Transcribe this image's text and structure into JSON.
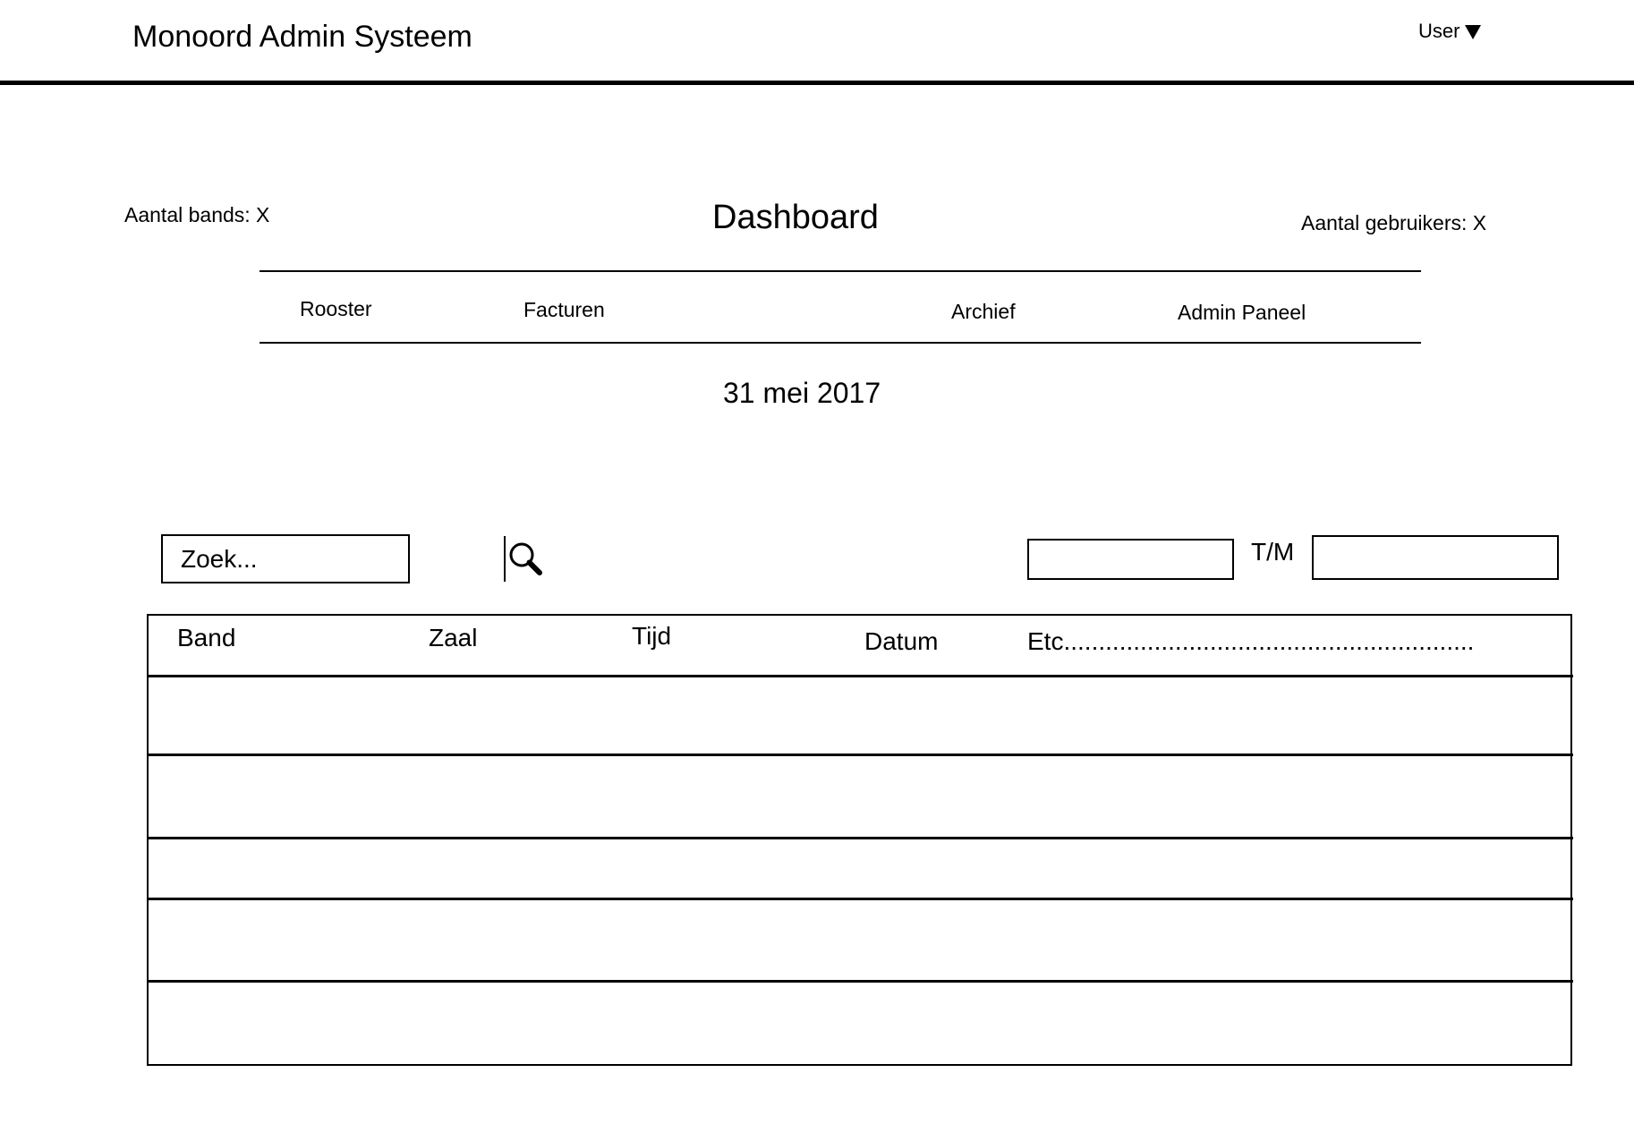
{
  "header": {
    "app_title": "Monoord Admin Systeem",
    "user_menu_label": "User"
  },
  "stats": {
    "bands": "Aantal bands: X",
    "users": "Aantal gebruikers: X"
  },
  "page": {
    "title": "Dashboard",
    "date": "31 mei 2017"
  },
  "nav": {
    "items": [
      {
        "label": "Rooster"
      },
      {
        "label": "Facturen"
      },
      {
        "label": "Archief"
      },
      {
        "label": "Admin Paneel"
      }
    ]
  },
  "search": {
    "placeholder": "Zoek...",
    "icon": "magnifier-icon"
  },
  "date_range": {
    "from_value": "",
    "separator": "T/M",
    "to_value": ""
  },
  "table": {
    "columns": [
      "Band",
      "Zaal",
      "Tijd",
      "Datum",
      "Etc..........................................................."
    ],
    "rows": [
      [],
      [],
      [],
      [],
      []
    ]
  }
}
